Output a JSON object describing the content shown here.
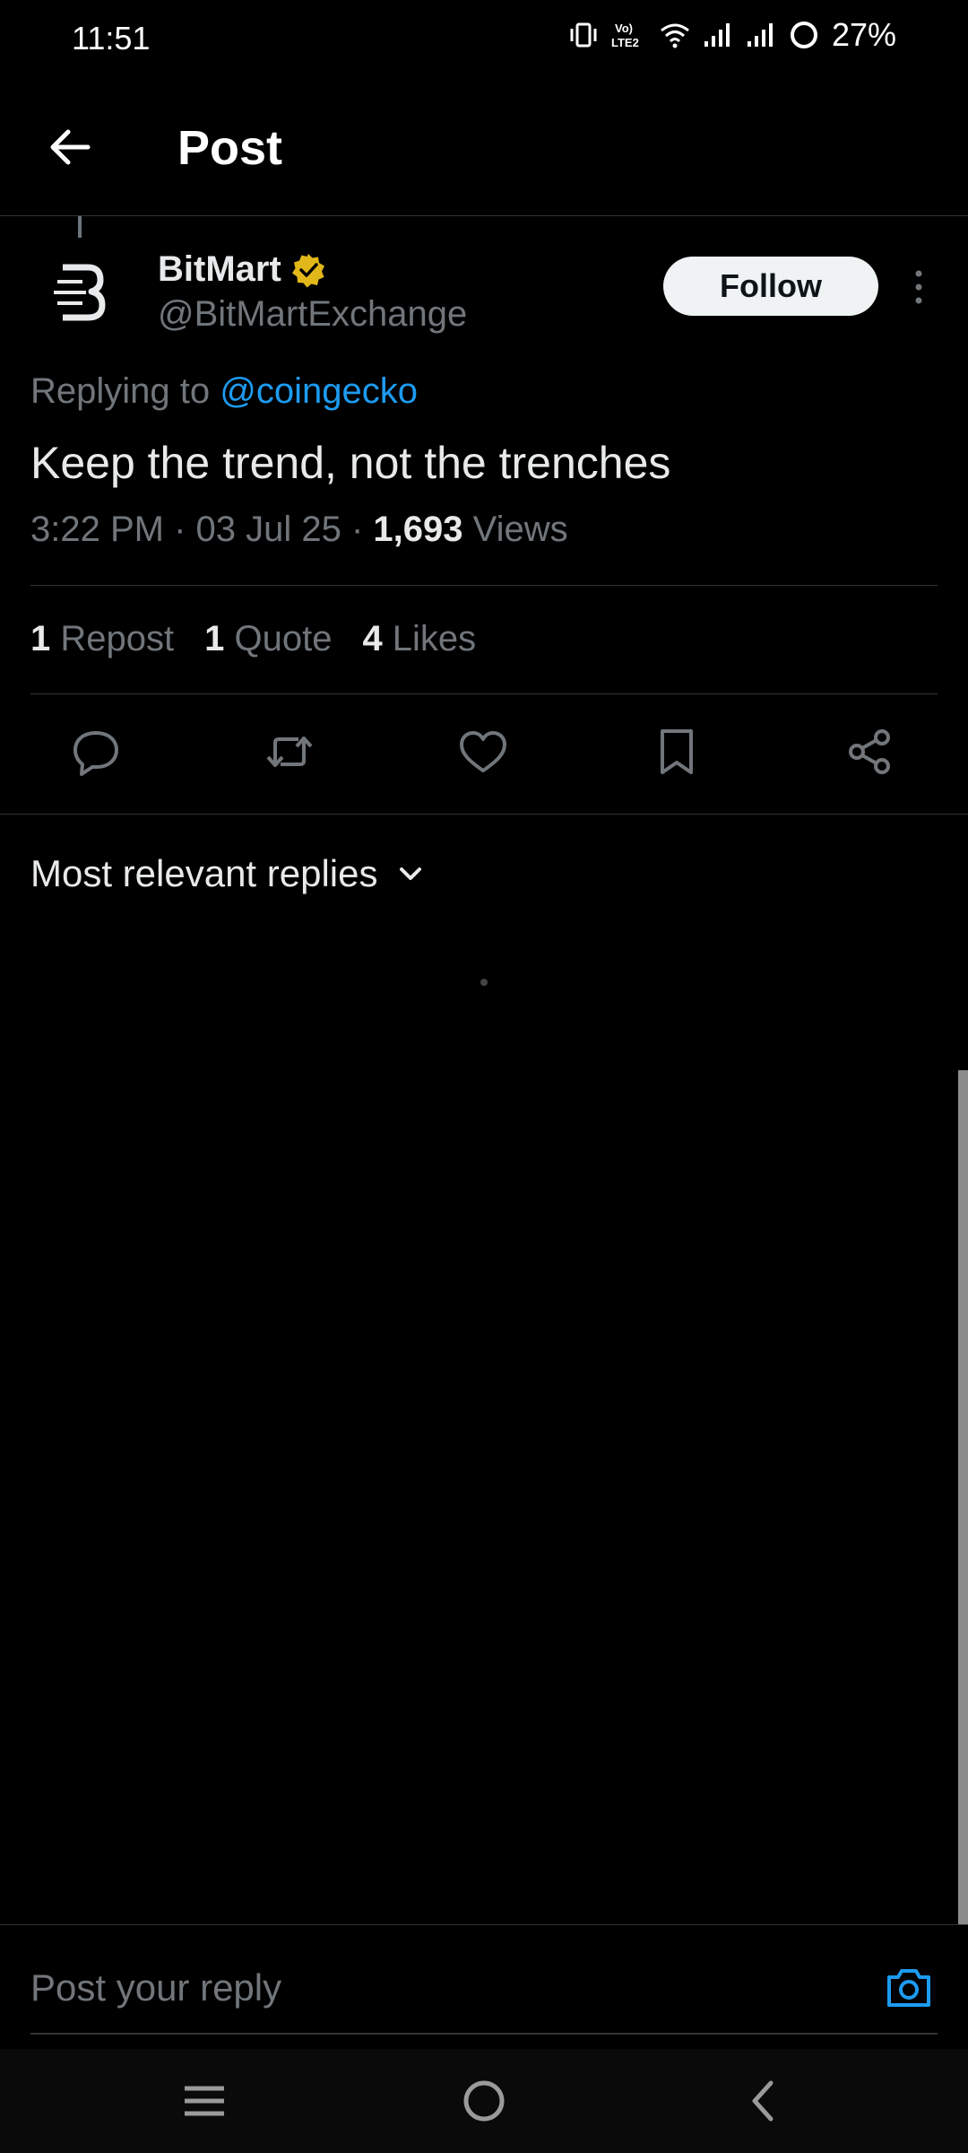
{
  "status_bar": {
    "time": "11:51",
    "network_label": "VoLTE2",
    "battery": "27%",
    "icons": [
      "vibrate-icon",
      "volte-icon",
      "wifi-icon",
      "signal-icon",
      "signal-icon",
      "battery-icon"
    ]
  },
  "header": {
    "title": "Post",
    "back_icon": "arrow-left-icon"
  },
  "post": {
    "author_name": "BitMart",
    "author_handle": "@BitMartExchange",
    "avatar_letter": "B",
    "verified_color": "#e2b719",
    "follow_label": "Follow",
    "replying_prefix": "Replying to ",
    "replying_to": "@coingecko",
    "text": "Keep the trend, not the trenches",
    "time": "3:22 PM",
    "separator": " · ",
    "date": "03 Jul 25",
    "views_count": "1,693",
    "views_label": " Views"
  },
  "stats": [
    {
      "count": "1",
      "label": " Repost"
    },
    {
      "count": "1",
      "label": " Quote"
    },
    {
      "count": "4",
      "label": " Likes"
    }
  ],
  "actions": [
    "reply-icon",
    "repost-icon",
    "like-icon",
    "bookmark-icon",
    "share-icon"
  ],
  "replies": {
    "sort_label": "Most relevant replies"
  },
  "reply_box": {
    "placeholder": "Post your reply"
  },
  "colors": {
    "background": "#000000",
    "link": "#1d9bf0",
    "muted": "#71767b",
    "text": "#e7e9ea",
    "divider": "#2f3336"
  },
  "navbar": [
    "menu-icon",
    "home-icon",
    "back-icon"
  ]
}
